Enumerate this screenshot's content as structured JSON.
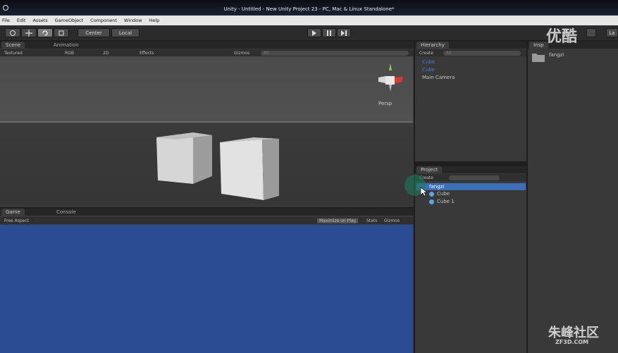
{
  "window": {
    "title": "Unity - Untitled - New Unity Project 23 - PC, Mac & Linux Standalone*"
  },
  "menu": [
    "File",
    "Edit",
    "Assets",
    "GameObject",
    "Component",
    "Window",
    "Help"
  ],
  "toolbar": {
    "pivot": "Center",
    "space": "Local",
    "layers": "La"
  },
  "scene_panel": {
    "tabs": [
      "Scene",
      "Animation"
    ],
    "shading": "Textured",
    "render": "RGB",
    "mode_2d": "2D",
    "effects": "Effects",
    "gizmos": "Gizmos",
    "search_placeholder": "All",
    "persp_label": "Persp"
  },
  "game_panel": {
    "tabs": [
      "Game",
      "Console"
    ],
    "aspect": "Free Aspect",
    "maximize": "Maximize on Play",
    "stats": "Stats",
    "gizmos": "Gizmos",
    "background_color": "#2b4c92"
  },
  "hierarchy": {
    "title": "Hierarchy",
    "create": "Create",
    "search_placeholder": "All",
    "items": [
      "Cube",
      "Cube",
      "Main Camera"
    ]
  },
  "project": {
    "title": "Project",
    "create": "Create",
    "items": [
      "fangzi",
      "Cube",
      "Cube 1"
    ]
  },
  "inspector": {
    "title": "Insp",
    "item": "fangzi"
  },
  "watermarks": {
    "youku": "优酷",
    "site": "朱峰社区",
    "site_url": "ZF3D.COM"
  }
}
